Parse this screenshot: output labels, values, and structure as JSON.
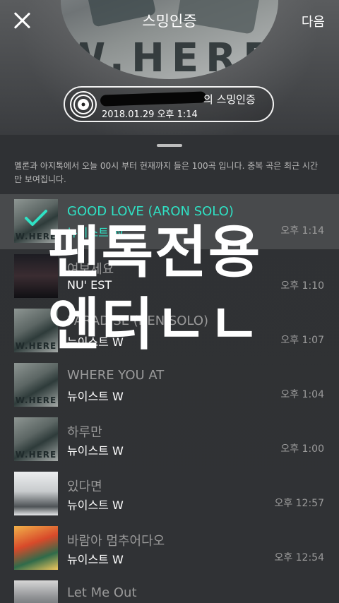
{
  "header": {
    "title": "스밍인증",
    "next_label": "다음",
    "album_wordmark": "W.HERE",
    "certificate": {
      "label_suffix": "의 스밍인증",
      "date": "2018.01.29 오후 1:14"
    }
  },
  "notice": "멜론과 아지톡에서 오늘 00시 부터 현재까지 들은 100곡 입니다. 중복 곡은 최근 시간만 보여집니다.",
  "songs": [
    {
      "title": "GOOD LOVE (ARON SOLO)",
      "artist": "뉴이스트 W",
      "time": "오후 1:14",
      "thumb_word": "W.HERE"
    },
    {
      "title": "여보세요",
      "artist": "NU' EST",
      "time": "오후 1:10",
      "thumb_word": ""
    },
    {
      "title": "PARADISE (REN SOLO)",
      "artist": "뉴이스트 W",
      "time": "오후 1:07",
      "thumb_word": "W.HERE"
    },
    {
      "title": "WHERE YOU AT",
      "artist": "뉴이스트 W",
      "time": "오후 1:04",
      "thumb_word": "W.HERE"
    },
    {
      "title": "하루만",
      "artist": "뉴이스트 W",
      "time": "오후 1:00",
      "thumb_word": "W.HERE"
    },
    {
      "title": "있다면",
      "artist": "뉴이스트 W",
      "time": "오후 12:57",
      "thumb_word": ""
    },
    {
      "title": "바람아 멈추어다오",
      "artist": "뉴이스트 W",
      "time": "오후 12:54",
      "thumb_word": ""
    },
    {
      "title": "Let Me Out",
      "artist": "",
      "time": "",
      "thumb_word": ""
    }
  ],
  "overlay": {
    "line1": "팬톡전용",
    "line2": "엔터ㄴㄴ"
  },
  "colors": {
    "accent": "#2fe1c4",
    "background": "#2e3033"
  }
}
